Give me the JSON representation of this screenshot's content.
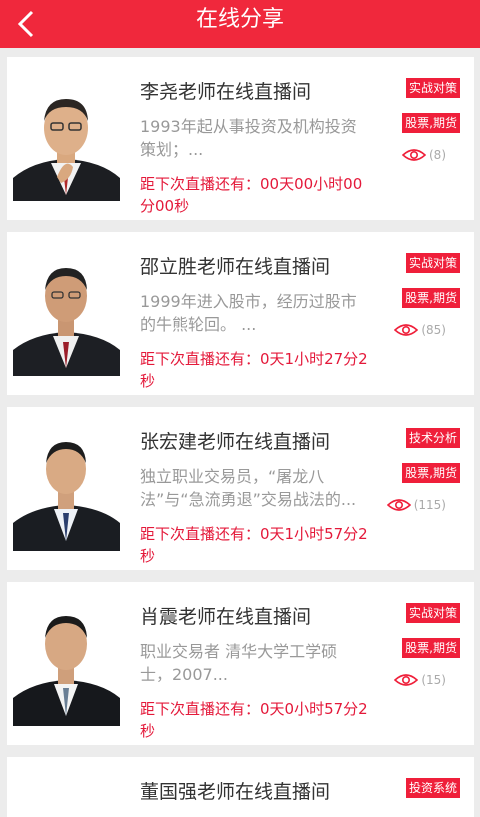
{
  "header": {
    "title": "在线分享",
    "back_icon": "chevron-left-icon"
  },
  "cards": [
    {
      "name": "李尧老师在线直播间",
      "desc": "1993年起从事投资及机构投资策划；...",
      "countdown": "距下次直播还有：00天00小时00分00秒",
      "tag1": "实战对策",
      "tag2": "股票,期货",
      "views": "(8)"
    },
    {
      "name": "邵立胜老师在线直播间",
      "desc": "1999年进入股市，经历过股市的牛熊轮回。 ...",
      "countdown": "距下次直播还有：0天1小时27分2秒",
      "tag1": "实战对策",
      "tag2": "股票,期货",
      "views": "(85)"
    },
    {
      "name": "张宏建老师在线直播间",
      "desc": "独立职业交易员，“屠龙八法”与“急流勇退”交易战法的...",
      "countdown": "距下次直播还有：0天1小时57分2秒",
      "tag1": "技术分析",
      "tag2": "股票,期货",
      "views": "(115)"
    },
    {
      "name": "肖震老师在线直播间",
      "desc": "职业交易者 清华大学工学硕士，2007...",
      "countdown": "距下次直播还有：0天0小时57分2秒",
      "tag1": "实战对策",
      "tag2": "股票,期货",
      "views": "(15)"
    },
    {
      "name": "董国强老师在线直播间",
      "tag1": "投资系统"
    }
  ],
  "colors": {
    "accent": "#f0283c",
    "tag": "#ef1f3a",
    "countdown": "#e4193a"
  }
}
